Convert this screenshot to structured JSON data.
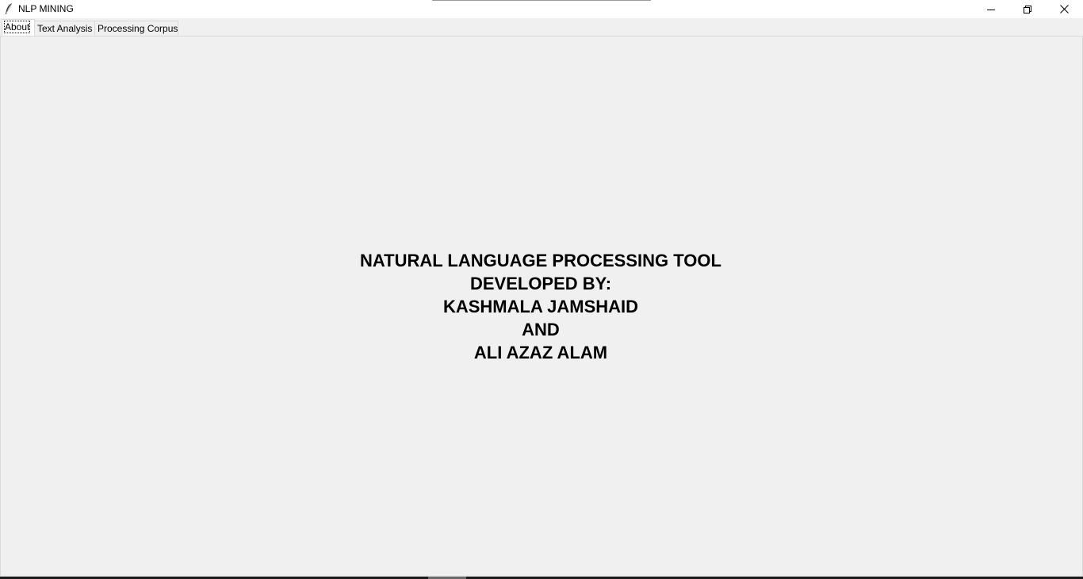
{
  "window": {
    "title": "NLP MINING",
    "icon": "feather-icon",
    "controls": {
      "minimize": "minimize-icon",
      "maximize": "restore-icon",
      "close": "close-icon"
    }
  },
  "tabs": [
    {
      "label": "About",
      "active": true
    },
    {
      "label": "Text Analysis",
      "active": false
    },
    {
      "label": "Processing Corpus",
      "active": false
    }
  ],
  "about": {
    "line1": "NATURAL LANGUAGE PROCESSING TOOL",
    "line2": "DEVELOPED BY:",
    "line3": "KASHMALA JAMSHAID",
    "line4": "AND",
    "line5": "ALI AZAZ ALAM"
  }
}
